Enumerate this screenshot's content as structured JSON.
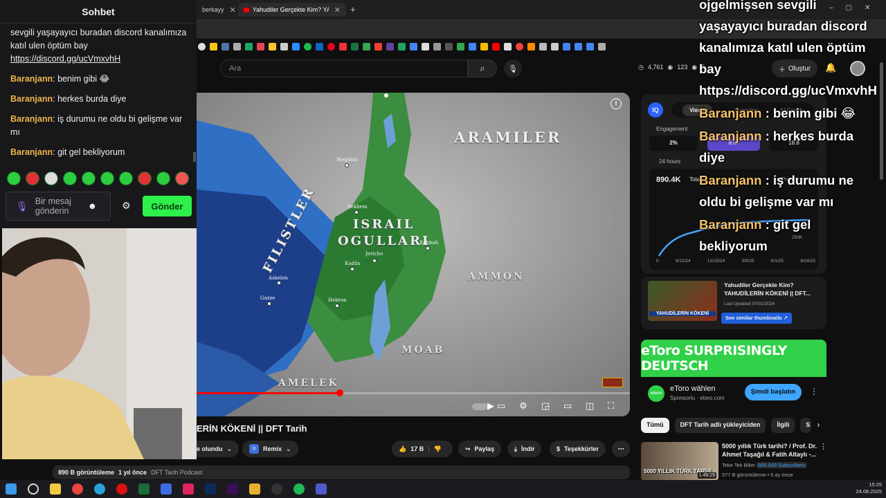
{
  "browser": {
    "tabs": [
      {
        "label": "berkayy",
        "active": false
      },
      {
        "label": "Yahudiler Gerçekte Kim? YAHUD",
        "active": true
      }
    ],
    "new_tab": "+"
  },
  "youtube": {
    "search_placeholder": "Ara",
    "stats": {
      "views": "4,761",
      "watching": "123",
      "extra": "5"
    },
    "create_label": "Oluştur"
  },
  "video": {
    "map_labels": {
      "aramiler": "ARAMILER",
      "israil": "ISRAIL",
      "ogullari": "OGULLARI",
      "filistler": "FILISTLER",
      "ammon": "AMMON",
      "moab": "MOAB",
      "amelek": "AMELEK"
    },
    "cities": [
      "Megiddo",
      "Sekhem",
      "Jericho",
      "Kudüs",
      "Askelon",
      "Gazze",
      "Hebron",
      "Rabbah"
    ],
    "progress": 0.33,
    "title": "ERİN KÖKENİ || DFT Tarih",
    "subscribed_label": "e olundu",
    "remix_label": "Remix",
    "likes": "17 B",
    "share_label": "Paylaş",
    "download_label": "İndir",
    "thanks_label": "Teşekkürler",
    "description": {
      "views": "890 B görüntüleme",
      "age": "1 yıl önce",
      "channel": "DFT Tarih Podcast"
    }
  },
  "iq_panel": {
    "logo": "IQ",
    "tabs": [
      "Views",
      "Overview",
      "AI Coach"
    ],
    "engagement_label": "Engagement",
    "engagement_value": "2%",
    "mid_value": "8.6k",
    "right_value": "18.8",
    "period": "24 hours",
    "total": "890.4K",
    "total_label": "Tota",
    "this_video": "This video",
    "y_tick": "250K",
    "x_ticks": [
      "0",
      "9/22/24",
      "12/15/24",
      "3/9/25",
      "6/1/25",
      "8/24/25"
    ]
  },
  "similar": {
    "title": "Yahudiler Gerçekte Kim? YAHUDİLERİN KÖKENİ || DFT...",
    "updated": "Last Updated 07/01/2024",
    "button": "See similar thumbnails ↗",
    "thumb_text": "YAHUDİLERİN KÖKENİ"
  },
  "ad": {
    "banner": "eToro SURPRISINGLY DEUTSCH",
    "name": "eToro wählen",
    "sponsor": "Sponsorlu · etoro.com",
    "cta": "Şimdi başlatın",
    "logo": "etoro"
  },
  "chips": [
    "Tümü",
    "DFT Tarih adlı yükleyiciden",
    "İlgili",
    "S"
  ],
  "recommendation": {
    "title": "5000 yıllık Türk tarihi? / Prof. Dr. Ahmet Taşağıl & Fatih Altaylı -...",
    "channel": "Teke Tek Bilim",
    "subscribers": "500.000 Subscribers",
    "meta": "577 B görüntüleme • 5 ay önce",
    "duration": "1:49:29",
    "thumb_text": "5000 YILLIK TÜRK TARİHİ"
  },
  "chat": {
    "title": "Sohbet",
    "messages": [
      {
        "user": "",
        "text": "sevgili yaşayayıcı buradan discord kanalımıza katıl ulen öptüm bay"
      },
      {
        "user": "",
        "text": "https://discord.gg/ucVmxvhH"
      },
      {
        "user": "Baranjann",
        "text": "benim gibi 😂"
      },
      {
        "user": "Baranjann",
        "text": "herkes burda diye"
      },
      {
        "user": "Baranjann",
        "text": "iş durumu ne oldu bi gelişme var mı"
      },
      {
        "user": "Baranjann",
        "text": "git gel bekliyorum"
      }
    ],
    "input_placeholder": "Bir mesaj gönderin",
    "send_label": "Gönder"
  },
  "overlay": {
    "lines": [
      {
        "user": "",
        "text": "ojgelmişsen sevgili yaşayayıcı buradan discord kanalımıza katıl ulen öptüm bay https://discord.gg/ucVmxvhH"
      },
      {
        "user": "Baranjann",
        "text": "benim gibi 😂"
      },
      {
        "user": "Baranjann",
        "text": "herkes burda diye"
      },
      {
        "user": "Baranjann",
        "text": "iş durumu ne oldu bi gelişme var mı"
      },
      {
        "user": "Baranjann",
        "text": "git gel bekliyorum"
      }
    ]
  },
  "taskbar": {
    "time": "15:25",
    "date": "24.08.2025"
  },
  "colors": {
    "accent_red": "#ff0000",
    "chat_user": "#f0b34a",
    "send_green": "#2ef04a",
    "etoro_green": "#30d048"
  }
}
